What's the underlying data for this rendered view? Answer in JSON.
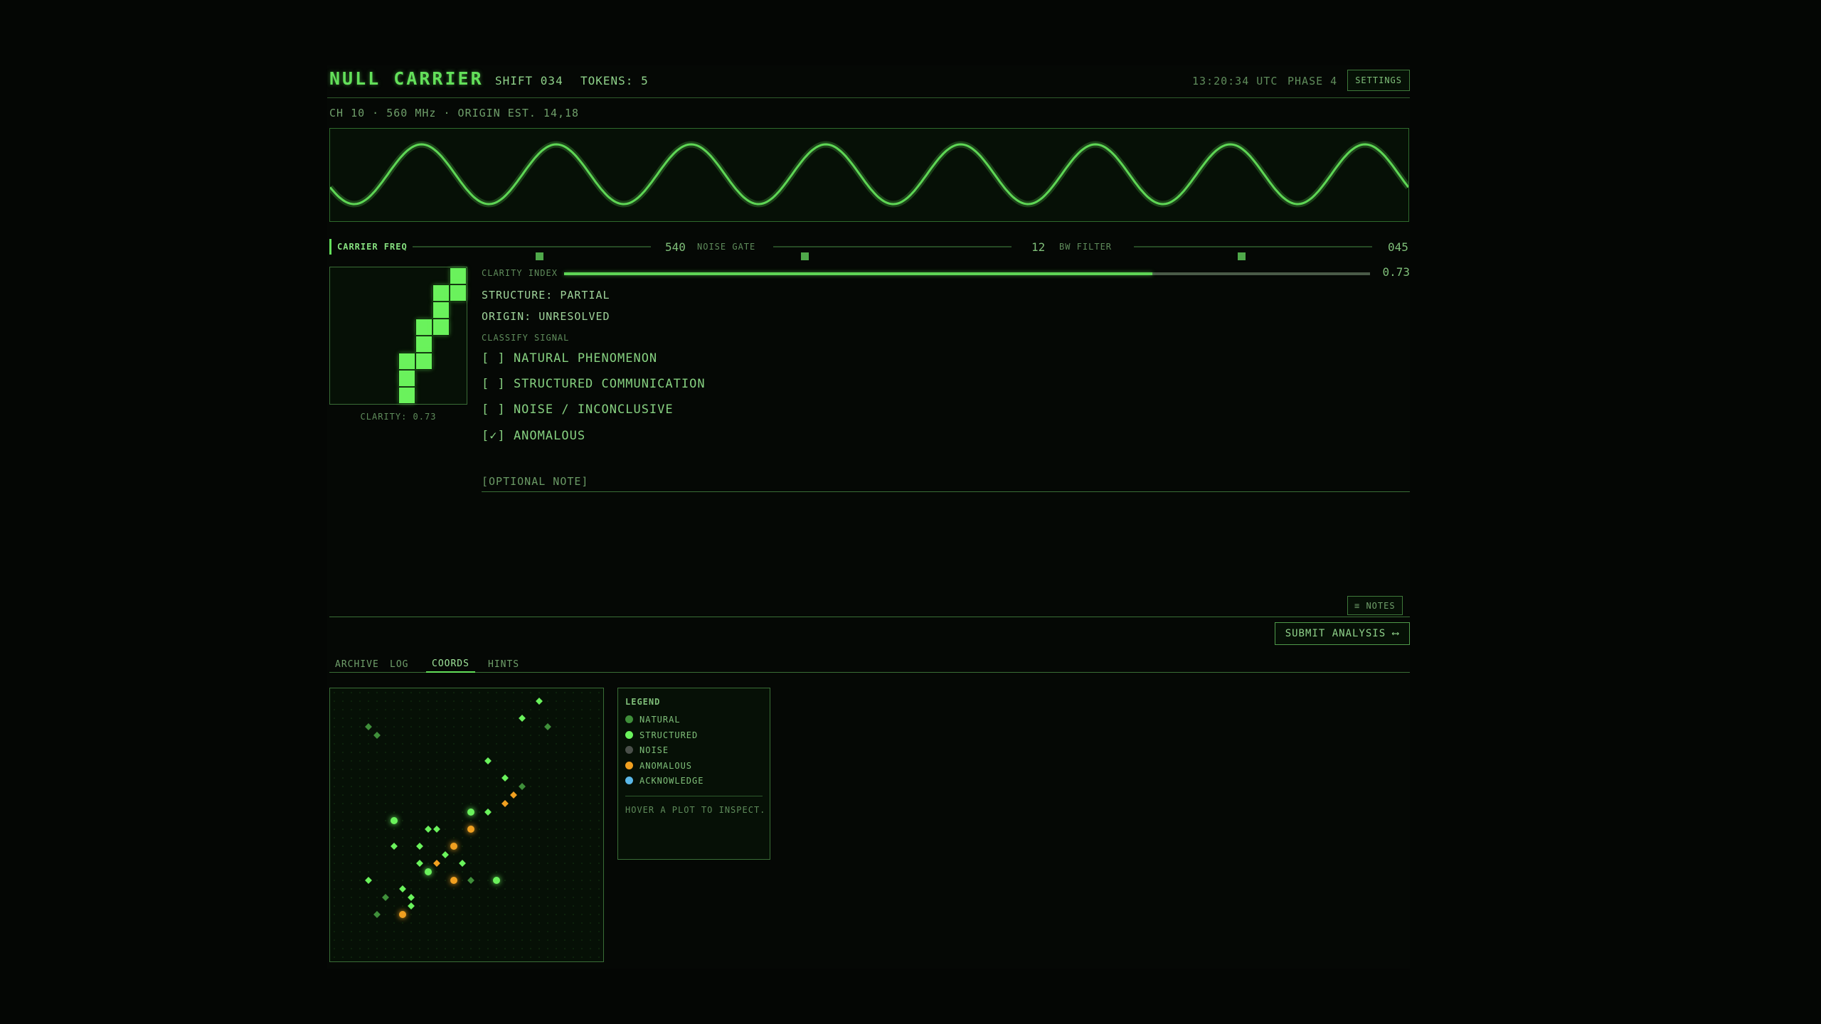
{
  "header": {
    "title": "NULL CARRIER",
    "shift": "SHIFT 034",
    "tokens": "TOKENS: 5",
    "time": "13:20:34 UTC",
    "phase": "PHASE 4",
    "settings_label": "SETTINGS"
  },
  "subheader": "CH 10 · 560 MHz · ORIGIN EST. 14,18",
  "waveform": {
    "color": "#5ed655",
    "cycles": 8
  },
  "sliders": [
    {
      "label": "CARRIER FREQ",
      "value": "540",
      "fraction": 0.53
    },
    {
      "label": "NOISE GATE",
      "value": "12",
      "fraction": 0.13
    },
    {
      "label": "BW FILTER",
      "value": "045",
      "fraction": 0.45
    }
  ],
  "glyph": {
    "caption": "CLARITY: 0.73",
    "cells": [
      [
        7,
        0
      ],
      [
        6,
        1
      ],
      [
        7,
        1
      ],
      [
        6,
        2
      ],
      [
        5,
        3
      ],
      [
        6,
        3
      ],
      [
        5,
        4
      ],
      [
        4,
        5
      ],
      [
        5,
        5
      ],
      [
        4,
        6
      ],
      [
        4,
        7
      ]
    ]
  },
  "analysis": {
    "clarity_label": "CLARITY INDEX",
    "clarity_value": "0.73",
    "clarity_fraction": 0.73,
    "structure": "STRUCTURE: PARTIAL",
    "origin": "ORIGIN: UNRESOLVED",
    "classify_label": "CLASSIFY SIGNAL",
    "options": [
      "[ ] NATURAL PHENOMENON",
      "[ ] STRUCTURED COMMUNICATION",
      "[ ] NOISE / INCONCLUSIVE",
      "[✓] ANOMALOUS"
    ],
    "note_placeholder": "[OPTIONAL NOTE]",
    "notes_label": "≡ NOTES",
    "submit_label": "SUBMIT ANALYSIS ⟷"
  },
  "tabs": [
    "ARCHIVE",
    "LOG",
    "COORDS",
    "HINTS"
  ],
  "active_tab": "COORDS",
  "legend": {
    "title": "LEGEND",
    "items": [
      {
        "label": "NATURAL",
        "color": "#3f8f3a"
      },
      {
        "label": "STRUCTURED",
        "color": "#6af25c"
      },
      {
        "label": "NOISE",
        "color": "#4a4f4a"
      },
      {
        "label": "ANOMALOUS",
        "color": "#f0a020"
      },
      {
        "label": "ACKNOWLEDGE",
        "color": "#5ab8e8"
      }
    ],
    "hint": "HOVER A PLOT TO INSPECT."
  },
  "coords": {
    "points": [
      {
        "x": 4,
        "y": 27,
        "kind": "natural",
        "mark": "diamond"
      },
      {
        "x": 5,
        "y": 26,
        "kind": "natural",
        "mark": "diamond"
      },
      {
        "x": 24,
        "y": 30,
        "kind": "structured",
        "mark": "diamond"
      },
      {
        "x": 25,
        "y": 27,
        "kind": "natural",
        "mark": "diamond"
      },
      {
        "x": 22,
        "y": 28,
        "kind": "structured",
        "mark": "diamond"
      },
      {
        "x": 18,
        "y": 23,
        "kind": "structured",
        "mark": "diamond"
      },
      {
        "x": 20,
        "y": 21,
        "kind": "structured",
        "mark": "diamond"
      },
      {
        "x": 22,
        "y": 20,
        "kind": "natural",
        "mark": "diamond"
      },
      {
        "x": 21,
        "y": 19,
        "kind": "anomalous",
        "mark": "diamond"
      },
      {
        "x": 20,
        "y": 18,
        "kind": "anomalous",
        "mark": "diamond"
      },
      {
        "x": 16,
        "y": 17,
        "kind": "structured",
        "mark": "dot"
      },
      {
        "x": 18,
        "y": 17,
        "kind": "structured",
        "mark": "diamond"
      },
      {
        "x": 16,
        "y": 15,
        "kind": "anomalous",
        "mark": "dot"
      },
      {
        "x": 7,
        "y": 16,
        "kind": "structured",
        "mark": "dot"
      },
      {
        "x": 11,
        "y": 15,
        "kind": "structured",
        "mark": "diamond"
      },
      {
        "x": 12,
        "y": 15,
        "kind": "structured",
        "mark": "diamond"
      },
      {
        "x": 7,
        "y": 13,
        "kind": "structured",
        "mark": "diamond"
      },
      {
        "x": 10,
        "y": 13,
        "kind": "structured",
        "mark": "diamond"
      },
      {
        "x": 14,
        "y": 13,
        "kind": "anomalous",
        "mark": "dot"
      },
      {
        "x": 13,
        "y": 12,
        "kind": "structured",
        "mark": "diamond"
      },
      {
        "x": 12,
        "y": 11,
        "kind": "anomalous",
        "mark": "diamond"
      },
      {
        "x": 10,
        "y": 11,
        "kind": "structured",
        "mark": "diamond"
      },
      {
        "x": 15,
        "y": 11,
        "kind": "structured",
        "mark": "diamond"
      },
      {
        "x": 11,
        "y": 10,
        "kind": "structured",
        "mark": "dot"
      },
      {
        "x": 4,
        "y": 9,
        "kind": "structured",
        "mark": "diamond"
      },
      {
        "x": 8,
        "y": 8,
        "kind": "structured",
        "mark": "diamond"
      },
      {
        "x": 14,
        "y": 9,
        "kind": "anomalous",
        "mark": "dot"
      },
      {
        "x": 16,
        "y": 9,
        "kind": "natural",
        "mark": "diamond"
      },
      {
        "x": 19,
        "y": 9,
        "kind": "structured",
        "mark": "dot"
      },
      {
        "x": 9,
        "y": 7,
        "kind": "structured",
        "mark": "diamond"
      },
      {
        "x": 5,
        "y": 5,
        "kind": "natural",
        "mark": "diamond"
      },
      {
        "x": 6,
        "y": 7,
        "kind": "natural",
        "mark": "diamond"
      },
      {
        "x": 8,
        "y": 5,
        "kind": "anomalous",
        "mark": "dot"
      },
      {
        "x": 9,
        "y": 6,
        "kind": "structured",
        "mark": "diamond"
      }
    ]
  }
}
